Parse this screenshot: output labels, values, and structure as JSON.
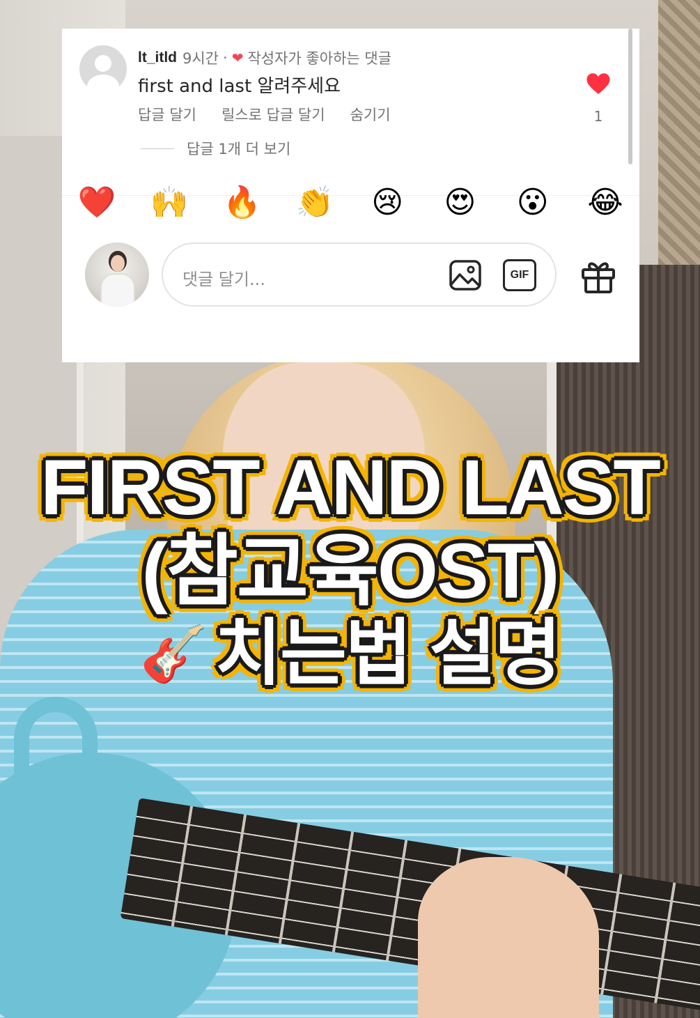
{
  "comment": {
    "username": "lt_itld",
    "time": "9시간",
    "separator": "·",
    "creator_liked": "작성자가 좋아하는 댓글",
    "text": "first and last 알려주세요",
    "actions": {
      "reply": "답글 달기",
      "reels_reply": "릴스로 답글 달기",
      "hide": "숨기기"
    },
    "like_count": "1",
    "view_replies": "답글 1개 더 보기"
  },
  "emoji_reactions": [
    "❤️",
    "🙌",
    "🔥",
    "👏",
    "😢",
    "😍",
    "😮",
    "😂"
  ],
  "composer": {
    "placeholder": "댓글 달기...",
    "gif_label": "GIF"
  },
  "caption": {
    "line1": "FIRST AND LAST",
    "line2": "(참교육OST)",
    "line3_emoji": "🎸",
    "line3": "치는법 설명"
  },
  "colors": {
    "like_red": "#ff3040",
    "caption_outline": "#f5b400",
    "secondary_text": "#737373"
  }
}
